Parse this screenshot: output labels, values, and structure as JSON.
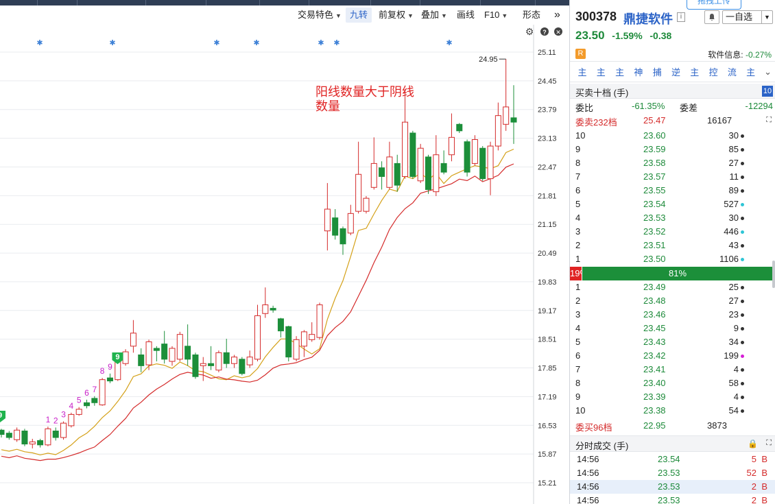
{
  "toolbar": {
    "buttons": [
      {
        "label": "交易特色",
        "dropdown": true
      },
      {
        "label": "九转",
        "dropdown": false,
        "active": true
      },
      {
        "label": "前复权",
        "dropdown": true
      },
      {
        "label": "叠加",
        "dropdown": true
      },
      {
        "label": "画线",
        "dropdown": false
      },
      {
        "label": "F10",
        "dropdown": true
      },
      {
        "label": "形态",
        "dropdown": false
      }
    ],
    "more_icon": "double-chevron-right-icon"
  },
  "chart_icons": [
    "gear-icon",
    "help-icon",
    "close-icon"
  ],
  "chart_data": {
    "type": "candlestick",
    "y_ticks": [
      "25.11",
      "24.45",
      "23.79",
      "23.13",
      "22.47",
      "21.81",
      "21.15",
      "20.49",
      "19.83",
      "19.17",
      "18.51",
      "17.85",
      "17.19",
      "16.53",
      "15.87",
      "15.21"
    ],
    "ylim": [
      15.21,
      25.11
    ],
    "high_marker": "24.95",
    "annotation": "阳线数量大于阴线数量",
    "annotation_lines": [
      "阳线数量大于阴线",
      "数量"
    ],
    "nine_turn_counts": [
      "1",
      "2",
      "3",
      "4",
      "5",
      "6",
      "7",
      "8",
      "9"
    ],
    "nine_turn_badges": [
      "9",
      "9"
    ],
    "colors": {
      "up": "#d42a2a",
      "down": "#1c8f3a",
      "ma_short": "#d4a017",
      "ma_long": "#d42a2a",
      "count_label": "#c81ec8"
    },
    "candles": [
      {
        "o": 16.42,
        "c": 16.32,
        "h": 16.45,
        "l": 16.25
      },
      {
        "o": 16.35,
        "c": 16.25,
        "h": 16.4,
        "l": 16.2
      },
      {
        "o": 16.2,
        "c": 16.42,
        "h": 16.48,
        "l": 16.15
      },
      {
        "o": 16.4,
        "c": 16.1,
        "h": 16.45,
        "l": 16.05
      },
      {
        "o": 16.1,
        "c": 16.15,
        "h": 16.22,
        "l": 16.0
      },
      {
        "o": 16.18,
        "c": 16.08,
        "h": 16.22,
        "l": 16.02
      },
      {
        "o": 16.08,
        "c": 16.45,
        "h": 16.5,
        "l": 16.05
      },
      {
        "o": 16.4,
        "c": 16.25,
        "h": 16.48,
        "l": 16.18
      },
      {
        "o": 16.25,
        "c": 16.58,
        "h": 16.62,
        "l": 16.2
      },
      {
        "o": 16.52,
        "c": 16.78,
        "h": 16.82,
        "l": 16.48
      },
      {
        "o": 16.78,
        "c": 16.9,
        "h": 16.95,
        "l": 16.75
      },
      {
        "o": 17.05,
        "c": 16.98,
        "h": 17.12,
        "l": 16.92
      },
      {
        "o": 17.15,
        "c": 17.05,
        "h": 17.2,
        "l": 16.98
      },
      {
        "o": 17.0,
        "c": 17.58,
        "h": 17.62,
        "l": 16.98
      },
      {
        "o": 17.62,
        "c": 17.55,
        "h": 17.72,
        "l": 17.5
      },
      {
        "o": 17.58,
        "c": 18.0,
        "h": 18.05,
        "l": 17.55
      },
      {
        "o": 17.95,
        "c": 18.22,
        "h": 18.28,
        "l": 17.9
      },
      {
        "o": 18.35,
        "c": 18.65,
        "h": 18.95,
        "l": 18.2
      },
      {
        "o": 18.15,
        "c": 17.9,
        "h": 18.3,
        "l": 17.75
      },
      {
        "o": 17.92,
        "c": 18.45,
        "h": 18.5,
        "l": 17.8
      },
      {
        "o": 18.3,
        "c": 18.25,
        "h": 18.35,
        "l": 18.0
      },
      {
        "o": 18.4,
        "c": 18.05,
        "h": 18.7,
        "l": 17.95
      },
      {
        "o": 18.0,
        "c": 18.3,
        "h": 18.35,
        "l": 17.9
      },
      {
        "o": 18.05,
        "c": 18.62,
        "h": 18.68,
        "l": 18.0
      },
      {
        "o": 18.35,
        "c": 18.05,
        "h": 18.85,
        "l": 17.9
      },
      {
        "o": 18.15,
        "c": 17.65,
        "h": 18.2,
        "l": 17.6
      },
      {
        "o": 17.9,
        "c": 17.95,
        "h": 18.1,
        "l": 17.55
      },
      {
        "o": 17.95,
        "c": 17.9,
        "h": 18.35,
        "l": 17.8
      },
      {
        "o": 17.8,
        "c": 18.2,
        "h": 18.25,
        "l": 17.75
      },
      {
        "o": 18.2,
        "c": 17.95,
        "h": 18.52,
        "l": 17.85
      },
      {
        "o": 17.95,
        "c": 18.1,
        "h": 18.15,
        "l": 17.85
      },
      {
        "o": 18.05,
        "c": 17.72,
        "h": 18.1,
        "l": 17.68
      },
      {
        "o": 17.92,
        "c": 18.1,
        "h": 18.25,
        "l": 17.85
      },
      {
        "o": 18.05,
        "c": 19.05,
        "h": 19.3,
        "l": 18.0
      },
      {
        "o": 19.1,
        "c": 19.3,
        "h": 19.7,
        "l": 19.0
      },
      {
        "o": 19.22,
        "c": 19.18,
        "h": 19.28,
        "l": 19.12
      },
      {
        "o": 18.98,
        "c": 18.7,
        "h": 19.0,
        "l": 18.55
      },
      {
        "o": 18.8,
        "c": 18.1,
        "h": 18.82,
        "l": 18.0
      },
      {
        "o": 18.05,
        "c": 18.5,
        "h": 18.58,
        "l": 18.0
      },
      {
        "o": 18.35,
        "c": 18.68,
        "h": 18.72,
        "l": 18.1
      },
      {
        "o": 18.5,
        "c": 18.62,
        "h": 18.9,
        "l": 18.45
      },
      {
        "o": 18.55,
        "c": 19.3,
        "h": 19.35,
        "l": 18.5
      },
      {
        "o": 21.0,
        "c": 21.5,
        "h": 22.1,
        "l": 20.55
      },
      {
        "o": 21.3,
        "c": 20.9,
        "h": 21.5,
        "l": 20.8
      },
      {
        "o": 21.05,
        "c": 20.7,
        "h": 21.1,
        "l": 20.45
      },
      {
        "o": 20.95,
        "c": 21.4,
        "h": 21.6,
        "l": 20.9
      },
      {
        "o": 21.45,
        "c": 22.3,
        "h": 23.05,
        "l": 21.4
      },
      {
        "o": 21.45,
        "c": 21.75,
        "h": 21.8,
        "l": 21.4
      },
      {
        "o": 22.0,
        "c": 22.55,
        "h": 23.15,
        "l": 21.95
      },
      {
        "o": 22.45,
        "c": 22.25,
        "h": 22.6,
        "l": 21.95
      },
      {
        "o": 22.0,
        "c": 22.7,
        "h": 23.05,
        "l": 21.95
      },
      {
        "o": 22.55,
        "c": 22.05,
        "h": 22.75,
        "l": 21.9
      },
      {
        "o": 22.25,
        "c": 23.5,
        "h": 24.25,
        "l": 22.2
      },
      {
        "o": 23.25,
        "c": 22.25,
        "h": 23.3,
        "l": 22.2
      },
      {
        "o": 22.15,
        "c": 22.9,
        "h": 23.0,
        "l": 22.1
      },
      {
        "o": 22.7,
        "c": 21.95,
        "h": 22.75,
        "l": 21.85
      },
      {
        "o": 21.9,
        "c": 22.75,
        "h": 23.2,
        "l": 21.8
      },
      {
        "o": 22.55,
        "c": 22.35,
        "h": 22.85,
        "l": 22.3
      },
      {
        "o": 22.75,
        "c": 23.15,
        "h": 23.7,
        "l": 22.6
      },
      {
        "o": 23.45,
        "c": 23.3,
        "h": 23.48,
        "l": 23.25
      },
      {
        "o": 23.05,
        "c": 22.35,
        "h": 23.1,
        "l": 22.25
      },
      {
        "o": 22.55,
        "c": 23.1,
        "h": 23.2,
        "l": 22.5
      },
      {
        "o": 22.9,
        "c": 22.2,
        "h": 22.95,
        "l": 22.15
      },
      {
        "o": 22.2,
        "c": 22.95,
        "h": 23.05,
        "l": 21.82
      },
      {
        "o": 22.95,
        "c": 23.65,
        "h": 23.95,
        "l": 22.85
      },
      {
        "o": 23.45,
        "c": 23.85,
        "h": 24.95,
        "l": 23.3
      },
      {
        "o": 23.6,
        "c": 23.5,
        "h": 24.35,
        "l": 23.0
      }
    ]
  },
  "stock": {
    "code": "300378",
    "name": "鼎捷软件",
    "price": "23.50",
    "change_pct": "-1.59%",
    "change": "-0.38",
    "info_badge": "i",
    "upload_tip": "拖拽上传",
    "watch_label": "一自选",
    "r_badge": "R",
    "sw_info_label": "软件信息:",
    "sw_info_value": "-0.27%"
  },
  "func_buttons": [
    "主",
    "主",
    "主",
    "神",
    "捕",
    "逆",
    "主",
    "控",
    "流",
    "主"
  ],
  "orderbook": {
    "title": "买卖十档 (手)",
    "levels_badge": "10",
    "weibi_label": "委比",
    "weibi_value": "-61.35%",
    "weicha_label": "委差",
    "weicha_value": "-12294",
    "sell_total_label": "委卖232档",
    "sell_total_price": "25.47",
    "sell_total_vol": "16167",
    "sells": [
      {
        "lv": "10",
        "price": "23.60",
        "qty": "30",
        "dot": "#333"
      },
      {
        "lv": "9",
        "price": "23.59",
        "qty": "85",
        "dot": "#333"
      },
      {
        "lv": "8",
        "price": "23.58",
        "qty": "27",
        "dot": "#333"
      },
      {
        "lv": "7",
        "price": "23.57",
        "qty": "11",
        "dot": "#333"
      },
      {
        "lv": "6",
        "price": "23.55",
        "qty": "89",
        "dot": "#333"
      },
      {
        "lv": "5",
        "price": "23.54",
        "qty": "527",
        "dot": "#2ec5d6"
      },
      {
        "lv": "4",
        "price": "23.53",
        "qty": "30",
        "dot": "#333"
      },
      {
        "lv": "3",
        "price": "23.52",
        "qty": "446",
        "dot": "#2ec5d6"
      },
      {
        "lv": "2",
        "price": "23.51",
        "qty": "43",
        "dot": "#333"
      },
      {
        "lv": "1",
        "price": "23.50",
        "qty": "1106",
        "dot": "#2ec5d6"
      }
    ],
    "ratio_buy": "19%",
    "ratio_sell": "81%",
    "ratio_buy_value": 0.19,
    "buys": [
      {
        "lv": "1",
        "price": "23.49",
        "qty": "25",
        "dot": "#333"
      },
      {
        "lv": "2",
        "price": "23.48",
        "qty": "27",
        "dot": "#333"
      },
      {
        "lv": "3",
        "price": "23.46",
        "qty": "23",
        "dot": "#333"
      },
      {
        "lv": "4",
        "price": "23.45",
        "qty": "9",
        "dot": "#333"
      },
      {
        "lv": "5",
        "price": "23.43",
        "qty": "34",
        "dot": "#333"
      },
      {
        "lv": "6",
        "price": "23.42",
        "qty": "199",
        "dot": "#d61ed6"
      },
      {
        "lv": "7",
        "price": "23.41",
        "qty": "4",
        "dot": "#333"
      },
      {
        "lv": "8",
        "price": "23.40",
        "qty": "58",
        "dot": "#333"
      },
      {
        "lv": "9",
        "price": "23.39",
        "qty": "4",
        "dot": "#333"
      },
      {
        "lv": "10",
        "price": "23.38",
        "qty": "54",
        "dot": "#333"
      }
    ],
    "buy_total_label": "委买96档",
    "buy_total_price": "22.95",
    "buy_total_vol": "3873"
  },
  "time_sales": {
    "title": "分时成交 (手)",
    "rows": [
      {
        "time": "14:56",
        "price": "23.54",
        "vol": "5",
        "side": "B",
        "highlight": false
      },
      {
        "time": "14:56",
        "price": "23.53",
        "vol": "52",
        "side": "B",
        "highlight": false
      },
      {
        "time": "14:56",
        "price": "23.53",
        "vol": "2",
        "side": "B",
        "highlight": true
      },
      {
        "time": "14:56",
        "price": "23.53",
        "vol": "2",
        "side": "B",
        "highlight": false
      }
    ]
  }
}
